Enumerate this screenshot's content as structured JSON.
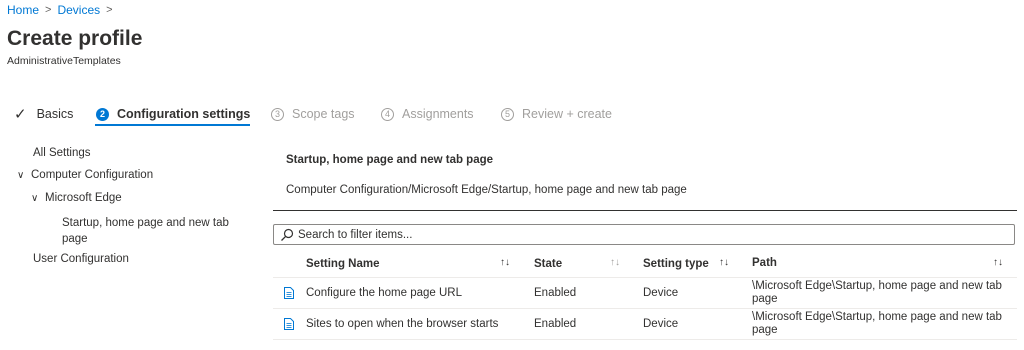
{
  "breadcrumb": {
    "home": "Home",
    "devices": "Devices",
    "sep": ">"
  },
  "page": {
    "title": "Create profile",
    "subtitle": "AdministrativeTemplates"
  },
  "steps": [
    {
      "label": "Basics",
      "num": "",
      "status": "done"
    },
    {
      "label": "Configuration settings",
      "num": "2",
      "status": "active"
    },
    {
      "label": "Scope tags",
      "num": "3",
      "status": "disabled"
    },
    {
      "label": "Assignments",
      "num": "4",
      "status": "disabled"
    },
    {
      "label": "Review + create",
      "num": "5",
      "status": "disabled"
    }
  ],
  "tree": {
    "all_settings": "All Settings",
    "computer_configuration": "Computer Configuration",
    "microsoft_edge": "Microsoft Edge",
    "startup_line1": "Startup, home page and new tab",
    "startup_line2": "page",
    "user_configuration": "User Configuration"
  },
  "section": {
    "title": "Startup, home page and new tab page",
    "path": "Computer Configuration/Microsoft Edge/Startup, home page and new tab page"
  },
  "filter": {
    "placeholder": "Search to filter items..."
  },
  "table": {
    "headers": {
      "name": "Setting Name",
      "state": "State",
      "type": "Setting type",
      "path": "Path"
    },
    "sort_glyph": "↑↓",
    "rows": [
      {
        "name": "Configure the home page URL",
        "state": "Enabled",
        "type": "Device",
        "path": "\\Microsoft Edge\\Startup, home page and new tab page"
      },
      {
        "name": "Sites to open when the browser starts",
        "state": "Enabled",
        "type": "Device",
        "path": "\\Microsoft Edge\\Startup, home page and new tab page"
      }
    ]
  },
  "colors": {
    "accent": "#0078d4",
    "text": "#323130",
    "disabled": "#a19f9d"
  },
  "icons": {
    "check": "checkmark-icon",
    "search": "search-icon",
    "doc": "document-icon",
    "chevron": "chevron-down-icon",
    "sort": "sort-icon"
  }
}
